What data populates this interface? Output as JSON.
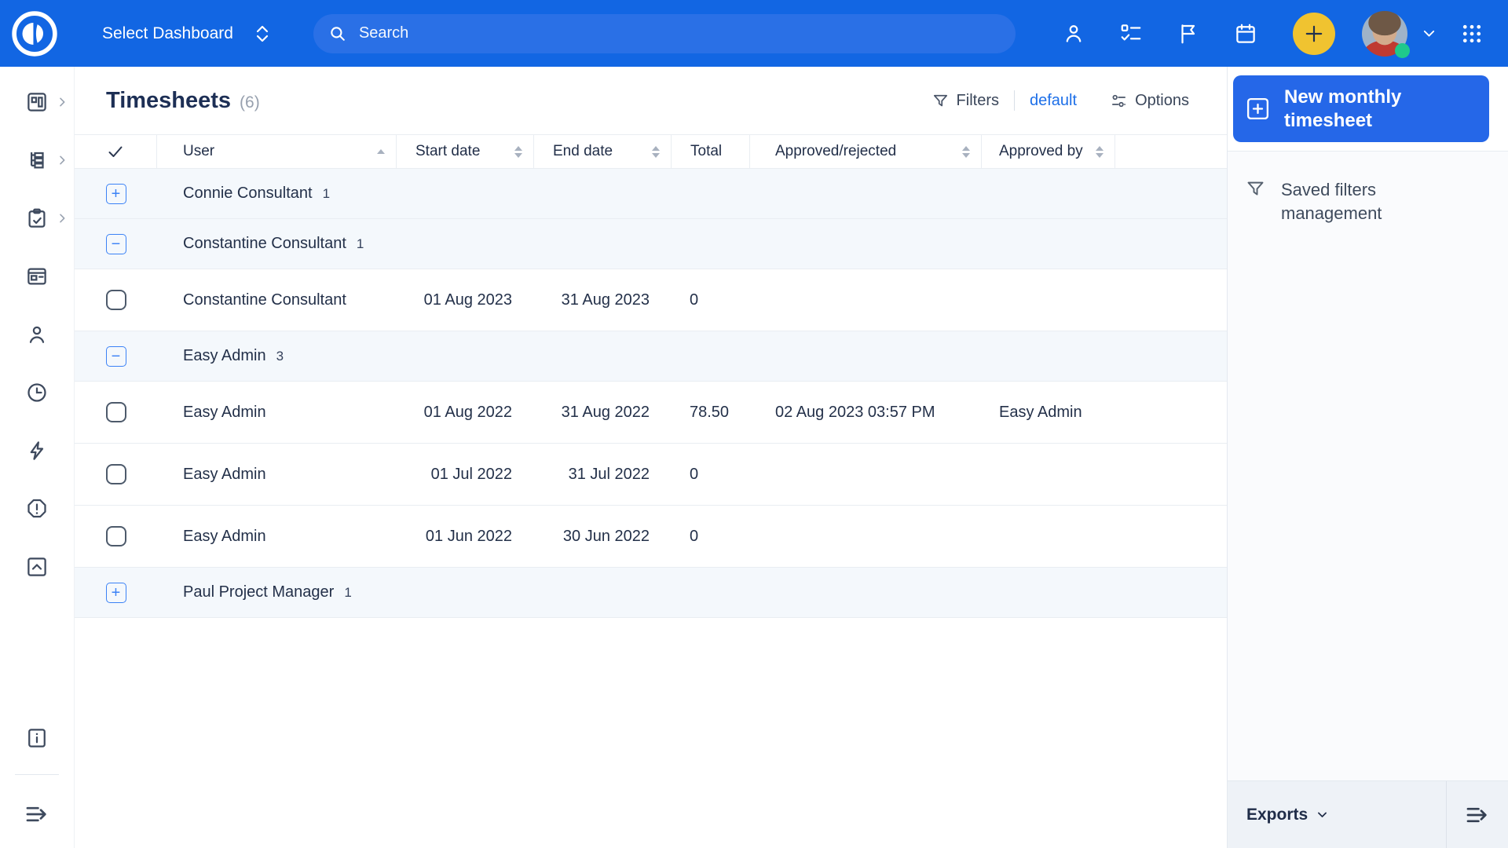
{
  "topbar": {
    "dashboard_selector": "Select Dashboard",
    "search_placeholder": "Search"
  },
  "page_header": {
    "title": "Timesheets",
    "count": "(6)",
    "filters_label": "Filters",
    "saved_filter_name": "default",
    "options_label": "Options"
  },
  "table": {
    "columns": {
      "user": "User",
      "start": "Start date",
      "end": "End date",
      "total": "Total",
      "approved": "Approved/rejected",
      "approved_by": "Approved by"
    },
    "rows": [
      {
        "type": "group",
        "expanded": false,
        "name": "Connie Consultant",
        "count": "1"
      },
      {
        "type": "group",
        "expanded": true,
        "name": "Constantine Consultant",
        "count": "1"
      },
      {
        "type": "data",
        "user": "Constantine Consultant",
        "start": "01 Aug 2023",
        "end": "31 Aug 2023",
        "total": "0",
        "approved": "",
        "approved_by": ""
      },
      {
        "type": "group",
        "expanded": true,
        "name": "Easy Admin",
        "count": "3"
      },
      {
        "type": "data",
        "user": "Easy Admin",
        "start": "01 Aug 2022",
        "end": "31 Aug 2022",
        "total": "78.50",
        "approved": "02 Aug 2023 03:57 PM",
        "approved_by": "Easy Admin"
      },
      {
        "type": "data",
        "user": "Easy Admin",
        "start": "01 Jul 2022",
        "end": "31 Jul 2022",
        "total": "0",
        "approved": "",
        "approved_by": ""
      },
      {
        "type": "data",
        "user": "Easy Admin",
        "start": "01 Jun 2022",
        "end": "30 Jun 2022",
        "total": "0",
        "approved": "",
        "approved_by": ""
      },
      {
        "type": "group",
        "expanded": false,
        "name": "Paul Project Manager",
        "count": "1"
      }
    ]
  },
  "action_panel": {
    "new_button_label": "New monthly timesheet",
    "saved_filters_label": "Saved filters management",
    "exports_label": "Exports"
  },
  "colors": {
    "topbar_blue": "#1266E3",
    "search_pill_blue": "#2A70E6",
    "primary_button_blue": "#2567E8",
    "plus_button_yellow": "#F0C330",
    "presence_green": "#1FC98C",
    "link_blue": "#1D6FE8",
    "group_row_bg": "#F4F8FC"
  }
}
